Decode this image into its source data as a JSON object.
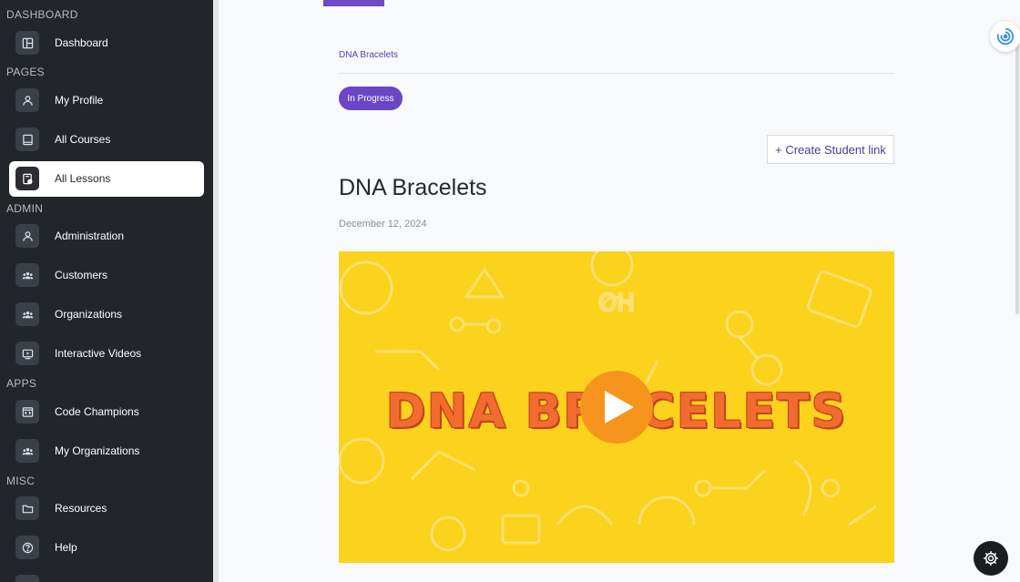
{
  "sidebar": {
    "sections": {
      "dashboard": "DASHBOARD",
      "pages": "PAGES",
      "admin": "ADMIN",
      "apps": "APPS",
      "misc": "MISC"
    },
    "items": [
      {
        "label": "Dashboard",
        "icon": "dashboard-icon"
      },
      {
        "label": "My Profile",
        "icon": "person-icon"
      },
      {
        "label": "All Courses",
        "icon": "book-icon"
      },
      {
        "label": "All Lessons",
        "icon": "lesson-icon",
        "active": true
      },
      {
        "label": "Administration",
        "icon": "person-icon"
      },
      {
        "label": "Customers",
        "icon": "group-icon"
      },
      {
        "label": "Organizations",
        "icon": "group-icon"
      },
      {
        "label": "Interactive Videos",
        "icon": "video-icon"
      },
      {
        "label": "Code Champions",
        "icon": "code-icon"
      },
      {
        "label": "My Organizations",
        "icon": "group-icon"
      },
      {
        "label": "Resources",
        "icon": "folder-icon"
      },
      {
        "label": "Help",
        "icon": "help-icon"
      }
    ]
  },
  "main": {
    "breadcrumb": "DNA Bracelets",
    "status": "In Progress",
    "create_link_label": "+ Create Student link",
    "title": "DNA Bracelets",
    "date": "December 12, 2024",
    "video": {
      "thumbnail_title": "DNA BRACELETS",
      "background_color": "#fbd21c",
      "title_color": "#f26b2f",
      "play_color": "#f7941d"
    }
  },
  "colors": {
    "accent": "#6a46c6",
    "sidebar_bg": "#22252a"
  }
}
